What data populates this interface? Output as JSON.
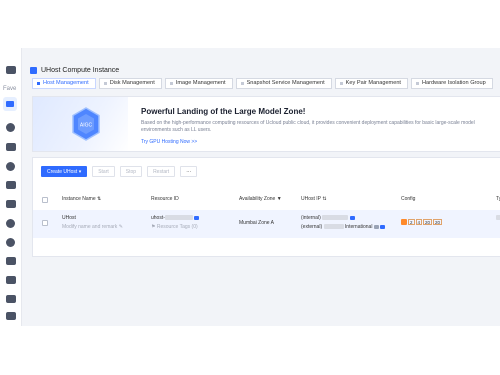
{
  "sidebar": {
    "fave_label": "Fave"
  },
  "page": {
    "title": "UHost Compute Instance"
  },
  "tabs": [
    {
      "label": "Host Management",
      "active": true
    },
    {
      "label": "Disk Management"
    },
    {
      "label": "Image Management"
    },
    {
      "label": "Snapshot Service Management"
    },
    {
      "label": "Key Pair Management"
    },
    {
      "label": "Hardware Isolation Group"
    }
  ],
  "banner": {
    "badge": "AIGC",
    "title": "Powerful Landing of the Large Model Zone!",
    "description": "Based on the high-performance computing resources of Ucloud public cloud, it provides convenient deployment capabilities for basic large-scale model environments such as LL users.",
    "link": "Try GPU Hosting Now >>"
  },
  "toolbar": {
    "create": "Create UHost",
    "start": "Start",
    "stop": "Stop",
    "restart": "Restart",
    "more": "···"
  },
  "table": {
    "headers": {
      "instance_name": "Instance Name",
      "resource_id": "Resource ID",
      "availability_zone": "Availability Zone",
      "uhost_ip": "UHost IP",
      "config": "Config",
      "type": "Ty"
    },
    "row": {
      "name": "UHost",
      "name_note": "Modify name and remark",
      "resource_id_prefix": "uhost-",
      "resource_tags": "Resource Tags",
      "resource_tags_count": "(0)",
      "zone": "Mumbai Zone A",
      "ip_internal_label": "(internal)",
      "ip_external_label": "(external)",
      "ip_international": "International",
      "config_values": [
        "2",
        "4",
        "20",
        "20"
      ]
    }
  },
  "colors": {
    "accent": "#2f6bff",
    "row_highlight": "#f0f4ff",
    "config_badge": "#ff8a2b"
  }
}
